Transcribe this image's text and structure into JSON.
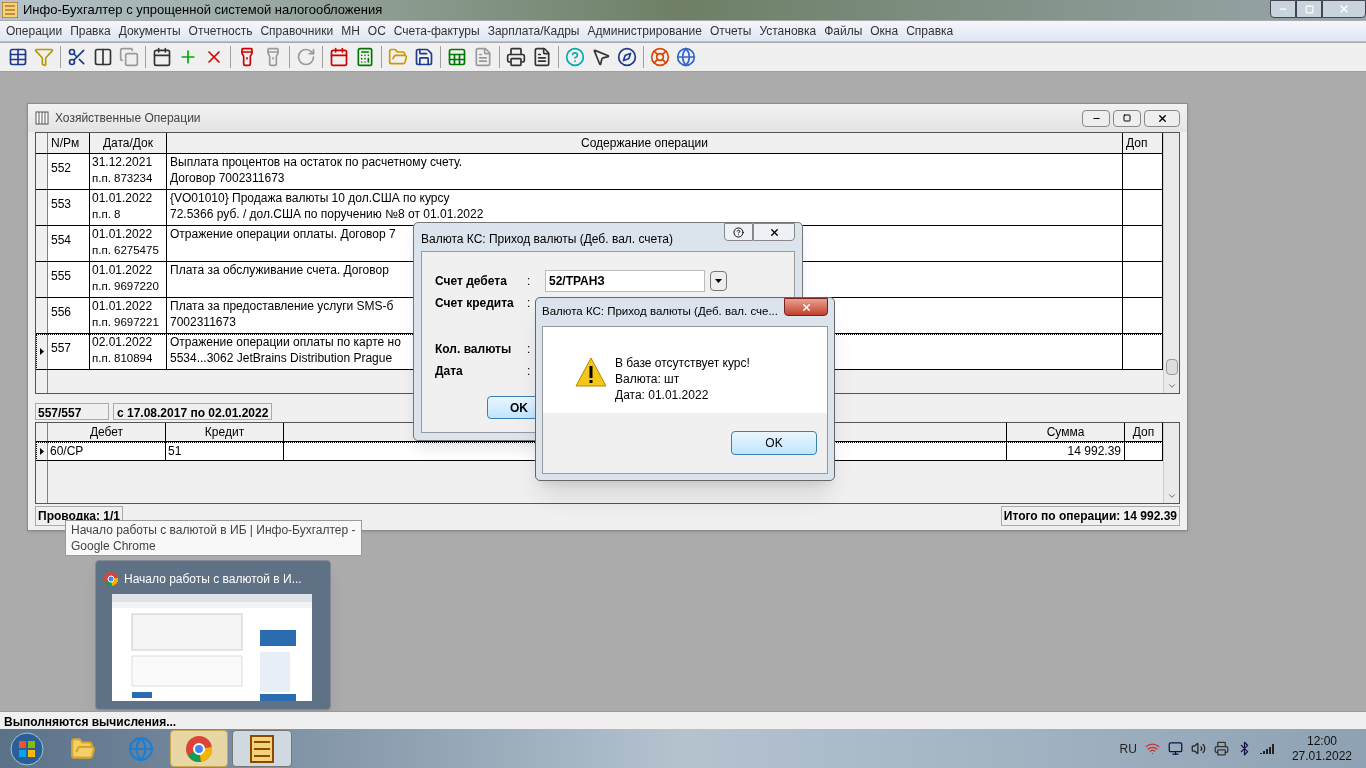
{
  "app": {
    "title": "Инфо-Бухгалтер с упрощенной системой налогообложения"
  },
  "menu": [
    "Операции",
    "Правка",
    "Документы",
    "Отчетность",
    "Справочники",
    "МН",
    "ОС",
    "Счета-фактуры",
    "Зарплата/Кадры",
    "Администрирование",
    "Отчеты",
    "Установка",
    "Файлы",
    "Окна",
    "Справка"
  ],
  "operations_window": {
    "title": "Хозяйственные Операции",
    "columns": [
      "N/Рм",
      "Дата/Док",
      "Содержание операции",
      "Доп"
    ],
    "rows": [
      {
        "number": "552",
        "date": "31.12.2021",
        "doc": "п.п. 873234",
        "content": [
          "Выплата процентов на остаток по расчетному счету.",
          "Договор 7002311673"
        ],
        "selected": false
      },
      {
        "number": "553",
        "date": "01.01.2022",
        "doc": "п.п. 8",
        "content": [
          "{VO01010} Продажа валюты 10 дол.США по курсу",
          "72.5366 руб. / дол.США по поручению №8 от 01.01.2022"
        ],
        "selected": false
      },
      {
        "number": "554",
        "date": "01.01.2022",
        "doc": "п.п. 6275475",
        "content": [
          "Отражение операции оплаты. Договор 7"
        ],
        "selected": false
      },
      {
        "number": "555",
        "date": "01.01.2022",
        "doc": "п.п. 9697220",
        "content": [
          "Плата за обслуживание счета. Договор"
        ],
        "selected": false
      },
      {
        "number": "556",
        "date": "01.01.2022",
        "doc": "п.п. 9697221",
        "content": [
          "Плата за предоставление услуги SMS-б",
          "7002311673"
        ],
        "selected": false
      },
      {
        "number": "557",
        "date": "02.01.2022",
        "doc": "п.п. 810894",
        "content": [
          "Отражение операции оплаты по карте но",
          "5534...3062 JetBrains Distribution Prague"
        ],
        "selected": true
      }
    ],
    "record_counter": "557/557",
    "period": "с 17.08.2017 по 02.01.2022",
    "entries": {
      "columns": [
        "Дебет",
        "Кредит",
        "Сумма",
        "Доп"
      ],
      "rows": [
        {
          "debit": "60/СР",
          "credit": "51",
          "amount": "14 992.39",
          "selected": true
        }
      ]
    },
    "entry_counter": "Проводка: 1/1",
    "total": "Итого по операции: 14 992.39"
  },
  "currency_dialog": {
    "title": "Валюта КС: Приход валюты (Деб. вал. счета)",
    "fields": [
      {
        "label": "Счет дебета",
        "separator": ":",
        "value": "52/ТРАНЗ"
      },
      {
        "label": "Счет кредита",
        "separator": ":"
      },
      {
        "label": "Кол. валюты",
        "separator": ":"
      },
      {
        "label": "Дата",
        "separator": ":"
      }
    ],
    "ok": "OK"
  },
  "alert": {
    "title": "Валюта КС: Приход валюты (Деб. вал. сче...",
    "lines": [
      "В базе отсутствует курс!",
      "Валюта: шт",
      "Дата: 01.01.2022"
    ],
    "ok": "OK"
  },
  "tooltip": "Начало работы с валютой в ИБ | Инфо-Бухгалтер -\nGoogle Chrome",
  "preview": {
    "title": "Начало работы с валютой в И..."
  },
  "status": "Выполняются вычисления...",
  "taskbar": {
    "language": "RU",
    "time": "12:00",
    "date": "27.01.2022"
  }
}
